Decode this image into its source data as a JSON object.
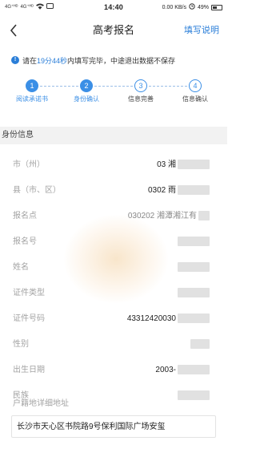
{
  "status_bar": {
    "signal_1": "4G⁺ᴴᴰ",
    "signal_2": "4G⁺ᴴᴰ",
    "time": "14:40",
    "speed": "0.00 KB/s",
    "battery": "49%"
  },
  "nav": {
    "title": "高考报名",
    "action": "填写说明"
  },
  "notice": {
    "prefix": "请在",
    "time": "19分44秒",
    "suffix": "内填写完毕，中途退出数据不保存"
  },
  "steps": [
    {
      "num": "1",
      "label": "阅读承诺书",
      "state": "active"
    },
    {
      "num": "2",
      "label": "身份确认",
      "state": "active"
    },
    {
      "num": "3",
      "label": "信息完善",
      "state": "inactive"
    },
    {
      "num": "4",
      "label": "信息确认",
      "state": "inactive"
    }
  ],
  "section": {
    "title": "身份信息"
  },
  "fields": [
    {
      "label": "市（州）",
      "value": "03 湘"
    },
    {
      "label": "县（市、区）",
      "value": "0302 雨"
    },
    {
      "label": "报名点",
      "value": "030202 湘潭湘江有"
    },
    {
      "label": "报名号",
      "value": ""
    },
    {
      "label": "姓名",
      "value": ""
    },
    {
      "label": "证件类型",
      "value": ""
    },
    {
      "label": "证件号码",
      "value": "43312420030"
    },
    {
      "label": "性别",
      "value": ""
    },
    {
      "label": "出生日期",
      "value": "2003-"
    },
    {
      "label": "民族",
      "value": ""
    }
  ],
  "address": {
    "label": "户籍地详细地址",
    "value": "长沙市天心区书院路9号保利国际广场安玺"
  },
  "colors": {
    "accent": "#2a7ed8",
    "step_active": "#3b8fe6",
    "label_gray": "#a3a3a3",
    "band": "#f2f2f2"
  }
}
